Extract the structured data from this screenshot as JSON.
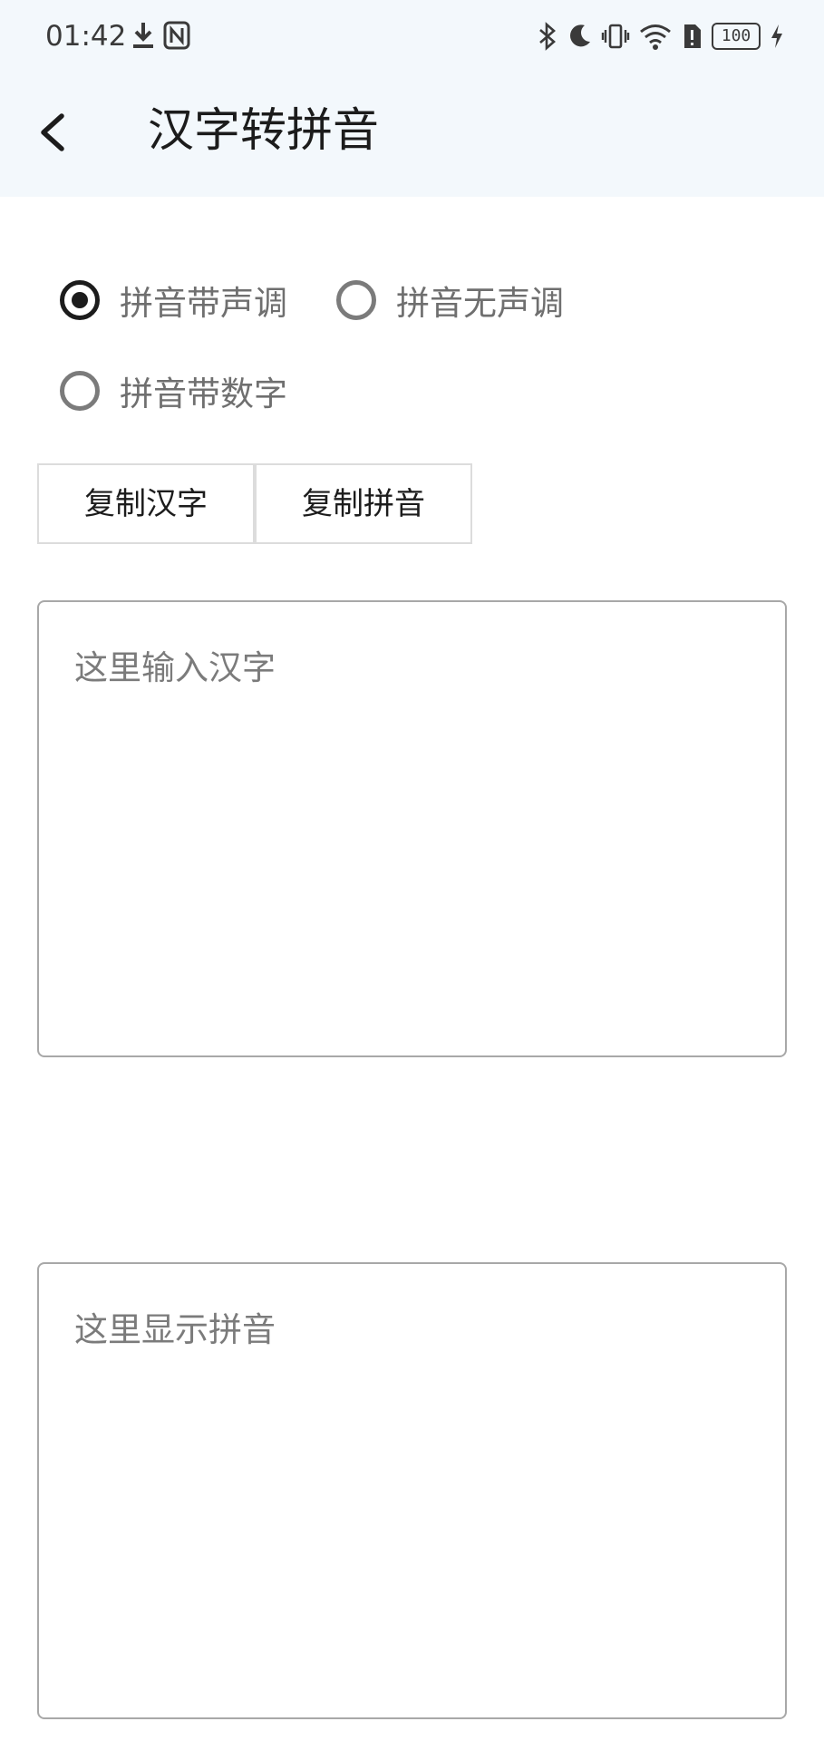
{
  "status_bar": {
    "time": "01:42",
    "battery": "100"
  },
  "app_bar": {
    "title": "汉字转拼音"
  },
  "options": [
    {
      "label": "拼音带声调",
      "checked": true
    },
    {
      "label": "拼音无声调",
      "checked": false
    },
    {
      "label": "拼音带数字",
      "checked": false
    }
  ],
  "buttons": {
    "copy_hanzi": "复制汉字",
    "copy_pinyin": "复制拼音"
  },
  "input": {
    "placeholder": "这里输入汉字"
  },
  "output": {
    "placeholder": "这里显示拼音"
  },
  "colors": {
    "appbar_bg": "#f3f8fc",
    "text_primary": "#1c1c1c",
    "text_hint": "#7b7b7b",
    "border": "#a8a8a8"
  }
}
